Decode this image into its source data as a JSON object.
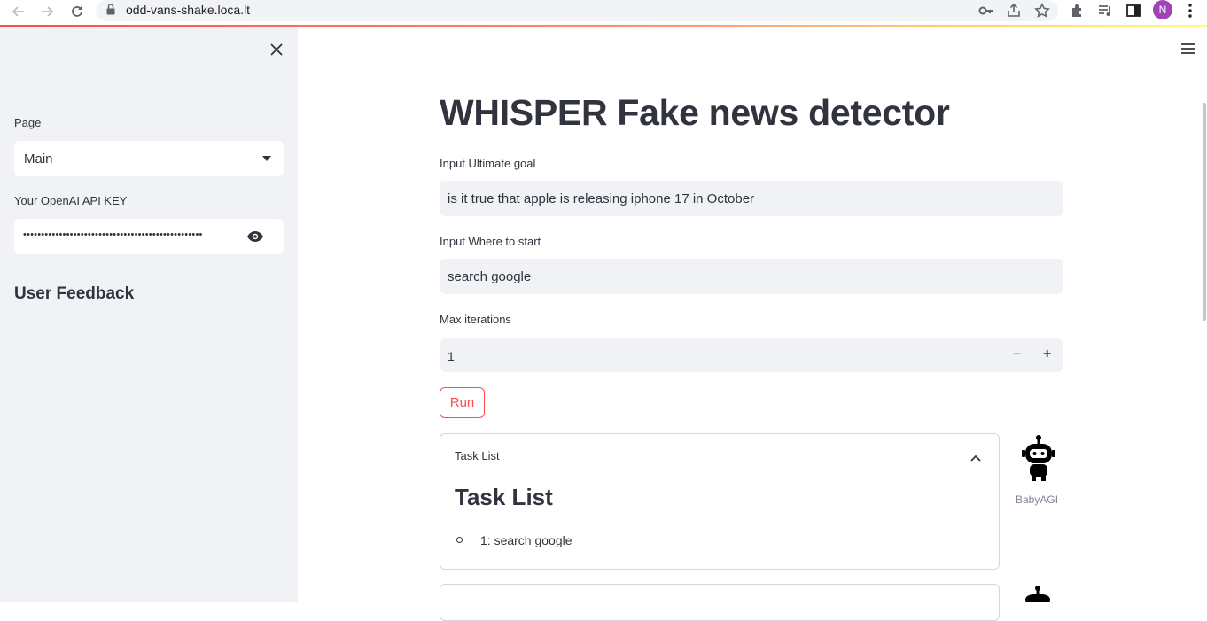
{
  "browser": {
    "url": "odd-vans-shake.loca.lt",
    "profile_initial": "N"
  },
  "sidebar": {
    "page_label": "Page",
    "page_value": "Main",
    "api_key_label": "Your OpenAI API KEY",
    "api_key_value": "••••••••••••••••••••••••••••••••••••••••••••••••••",
    "feedback_heading": "User Feedback"
  },
  "main": {
    "title": "WHISPER Fake news detector",
    "goal_label": "Input Ultimate goal",
    "goal_value": "is it true that apple is releasing iphone 17 in October",
    "start_label": "Input Where to start",
    "start_value": "search google",
    "iter_label": "Max iterations",
    "iter_value": "1",
    "run_label": "Run",
    "expander": {
      "header": "Task List",
      "title": "Task List",
      "item": "1: search google"
    },
    "bot_name": "BabyAGI"
  },
  "colors": {
    "accent": "#ff4b4b",
    "sidebar_bg": "#f0f2f6",
    "text": "#31333f"
  }
}
